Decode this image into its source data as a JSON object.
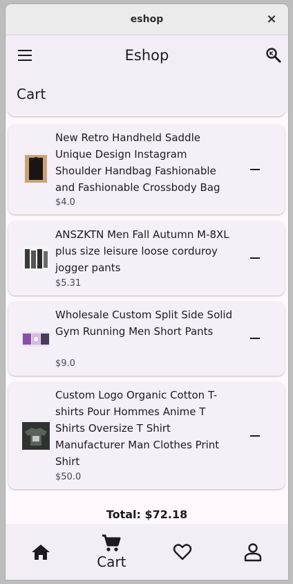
{
  "window": {
    "title": "eshop",
    "close_glyph": "×"
  },
  "appbar": {
    "title": "Eshop",
    "menu_icon": "hamburger-menu-icon",
    "search_icon": "search-icon"
  },
  "page": {
    "heading": "Cart"
  },
  "cart": {
    "items": [
      {
        "name": "New Retro Handheld Saddle Unique Design Instagram Shoulder Handbag Fashionable and Fashionable Crossbody Bag",
        "price": "$4.0",
        "thumb": "black-handbag"
      },
      {
        "name": "ANSZKTN Men Fall Autumn M-8XL plus size leisure loose corduroy jogger pants",
        "price": "$5.31",
        "thumb": "jogger-pants"
      },
      {
        "name": "Wholesale Custom Split Side Solid Gym Running Men Short Pants",
        "price": "$9.0",
        "thumb": "gym-shorts"
      },
      {
        "name": "Custom Logo Organic Cotton T-shirts Pour Hommes Anime T Shirts Oversize T Shirt Manufacturer Man Clothes Print Shirt",
        "price": "$50.0",
        "thumb": "anime-tshirt"
      }
    ],
    "total": "Total: $72.18"
  },
  "bottom_nav": {
    "items": [
      {
        "icon": "home-icon",
        "label": ""
      },
      {
        "icon": "cart-icon",
        "label": "Cart",
        "selected": true
      },
      {
        "icon": "heart-icon",
        "label": ""
      },
      {
        "icon": "person-icon",
        "label": ""
      }
    ]
  },
  "colors": {
    "background": "#fef7fb",
    "appbar": "#f3edf6",
    "card": "#f5eff7",
    "text": "#1c1b1f"
  }
}
